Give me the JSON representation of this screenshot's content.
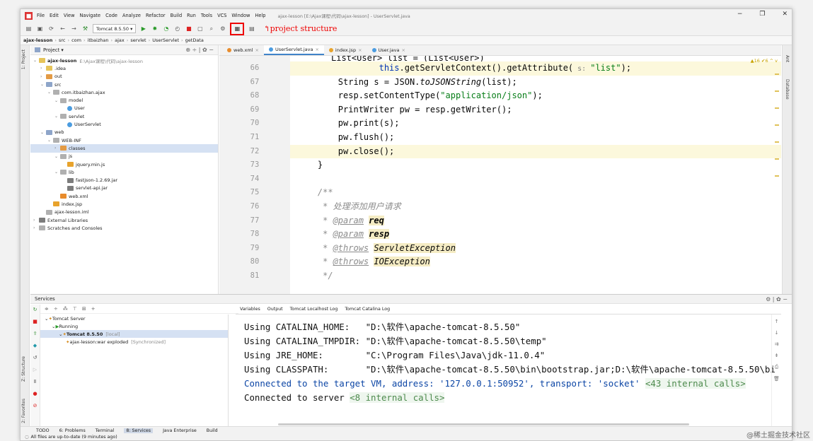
{
  "window": {
    "title": "ajax-lesson [E:\\Ajax课程\\代码\\ajax-lesson] - UserServlet.java"
  },
  "menu": [
    "File",
    "Edit",
    "View",
    "Navigate",
    "Code",
    "Analyze",
    "Refactor",
    "Build",
    "Run",
    "Tools",
    "VCS",
    "Window",
    "Help"
  ],
  "toolbar": {
    "run_config": "Tomcat 8.5.50 ▾",
    "annotation": "project structure"
  },
  "breadcrumb": [
    "ajax-lesson",
    "src",
    "com",
    "itbaizhan",
    "ajax",
    "servlet",
    "UserServlet",
    "getData"
  ],
  "project": {
    "header": "Project ▾",
    "tree": [
      {
        "label": "ajax-lesson",
        "extra": "E:\\Ajax课程\\代码\\ajax-lesson",
        "indent": 0,
        "icon": "fold",
        "open": true
      },
      {
        "label": ".idea",
        "indent": 1,
        "icon": "fold",
        "open": false
      },
      {
        "label": "out",
        "indent": 1,
        "icon": "fold-o",
        "open": false
      },
      {
        "label": "src",
        "indent": 1,
        "icon": "fold-b",
        "open": true
      },
      {
        "label": "com.itbaizhan.ajax",
        "indent": 2,
        "icon": "file",
        "open": true
      },
      {
        "label": "model",
        "indent": 3,
        "icon": "file",
        "open": true
      },
      {
        "label": "User",
        "indent": 4,
        "icon": "cls"
      },
      {
        "label": "servlet",
        "indent": 3,
        "icon": "file",
        "open": true
      },
      {
        "label": "UserServlet",
        "indent": 4,
        "icon": "cls"
      },
      {
        "label": "web",
        "indent": 1,
        "icon": "fold-b",
        "open": true
      },
      {
        "label": "WEB-INF",
        "indent": 2,
        "icon": "file",
        "open": true
      },
      {
        "label": "classes",
        "indent": 3,
        "icon": "fold-o",
        "open": false,
        "sel": true
      },
      {
        "label": "js",
        "indent": 3,
        "icon": "file",
        "open": true
      },
      {
        "label": "jquery.min.js",
        "indent": 4,
        "icon": "jsp"
      },
      {
        "label": "lib",
        "indent": 3,
        "icon": "file",
        "open": true
      },
      {
        "label": "fastjson-1.2.69.jar",
        "indent": 4,
        "icon": "lib"
      },
      {
        "label": "servlet-api.jar",
        "indent": 4,
        "icon": "lib"
      },
      {
        "label": "web.xml",
        "indent": 3,
        "icon": "xml"
      },
      {
        "label": "index.jsp",
        "indent": 2,
        "icon": "jsp"
      },
      {
        "label": "ajax-lesson.iml",
        "indent": 1,
        "icon": "file"
      },
      {
        "label": "External Libraries",
        "indent": 0,
        "icon": "lib",
        "open": false
      },
      {
        "label": "Scratches and Consoles",
        "indent": 0,
        "icon": "file",
        "open": false
      }
    ]
  },
  "tabs": [
    {
      "label": "web.xml",
      "color": "#e88c2c",
      "active": false
    },
    {
      "label": "UserServlet.java",
      "color": "#4b9ce0",
      "active": true
    },
    {
      "label": "index.jsp",
      "color": "#e8a32c",
      "active": false
    },
    {
      "label": "User.java",
      "color": "#4b9ce0",
      "active": false
    }
  ],
  "editor": {
    "inspections": "▲16 ✔6 ^ v",
    "line_numbers": [
      "66",
      "67",
      "68",
      "69",
      "70",
      "71",
      "72",
      "73",
      "74",
      "75",
      "76",
      "77",
      "78",
      "79",
      "80",
      "81"
    ],
    "partial_top": "List<User> list = (List<User>)",
    "lines": [
      "                this.getServletContext().getAttribute( s: \"list\");",
      "        String s = JSON.toJSONString(list);",
      "        resp.setContentType(\"application/json\");",
      "        PrintWriter pw = resp.getWriter();",
      "        pw.print(s);",
      "        pw.flush();",
      "        pw.close();",
      "    }",
      "",
      "    /**",
      "     * 处理添加用户请求",
      "     * @param req",
      "     * @param resp",
      "     * @throws ServletException",
      "     * @throws IOException",
      "     */"
    ]
  },
  "services": {
    "header": "Services",
    "tree": [
      {
        "label": "Tomcat Server",
        "indent": 0
      },
      {
        "label": "Running",
        "indent": 1
      },
      {
        "label": "Tomcat 8.5.50",
        "extra": "[local]",
        "indent": 2,
        "sel": true
      },
      {
        "label": "ajax-lesson:war exploded",
        "extra": "[Synchronized]",
        "indent": 3
      }
    ],
    "console_tabs": [
      "Variables",
      "Output",
      "Tomcat Localhost Log",
      "Tomcat Catalina Log"
    ],
    "console": [
      {
        "text": "Using CATALINA_HOME:   \"D:\\软件\\apache-tomcat-8.5.50\"",
        "blue": false
      },
      {
        "text": "Using CATALINA_TMPDIR: \"D:\\软件\\apache-tomcat-8.5.50\\temp\"",
        "blue": false
      },
      {
        "text": "Using JRE_HOME:        \"C:\\Program Files\\Java\\jdk-11.0.4\"",
        "blue": false
      },
      {
        "text": "Using CLASSPATH:       \"D:\\软件\\apache-tomcat-8.5.50\\bin\\bootstrap.jar;D:\\软件\\apache-tomcat-8.5.50\\bi",
        "blue": false
      },
      {
        "text": "Connected to the target VM, address: '127.0.0.1:50952', transport: 'socket' ",
        "fold": "<43 internal calls>",
        "blue": true
      },
      {
        "text": "Connected to server ",
        "fold": "<8 internal calls>",
        "blue": false
      }
    ]
  },
  "bottom_tabs": [
    "TODO",
    "6: Problems",
    "Terminal",
    "8: Services",
    "Java Enterprise",
    "Build"
  ],
  "status": "All files are up-to-date (9 minutes ago)",
  "watermark": "@稀土掘金技术社区"
}
